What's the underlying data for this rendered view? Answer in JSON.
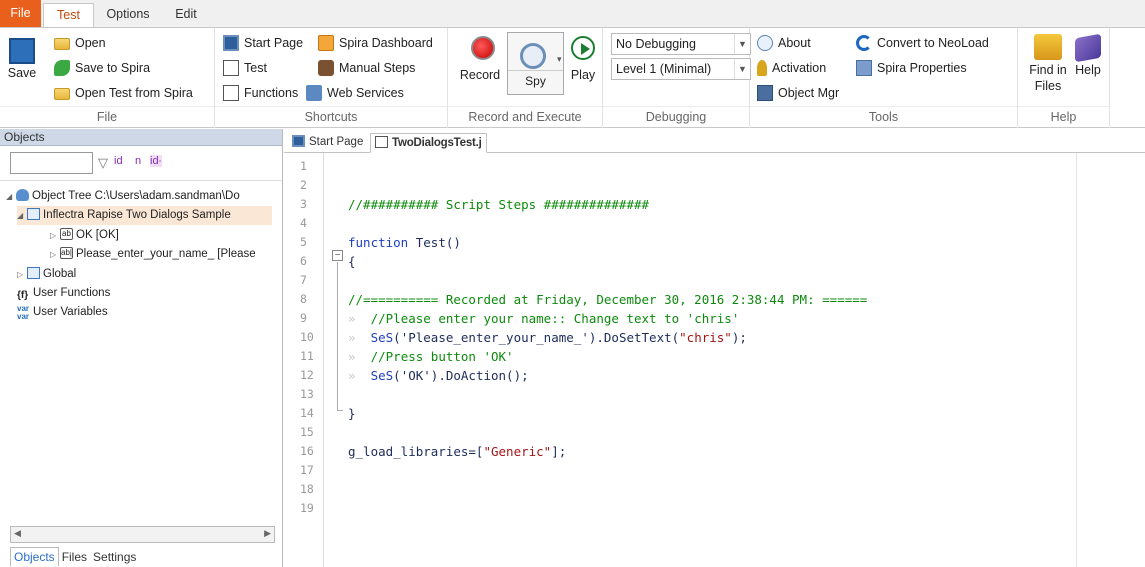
{
  "menu": {
    "tabs": [
      "File",
      "Test",
      "Options",
      "Edit"
    ]
  },
  "ribbon": {
    "file_group": {
      "save": "Save",
      "open": "Open",
      "save_spira": "Save to Spira",
      "open_spira": "Open Test from Spira",
      "caption": "File"
    },
    "shortcuts_group": {
      "start_page": "Start Page",
      "spira_dashboard": "Spira Dashboard",
      "test": "Test",
      "manual_steps": "Manual Steps",
      "functions": "Functions",
      "web_services": "Web Services",
      "caption": "Shortcuts"
    },
    "record_group": {
      "record": "Record",
      "spy": "Spy",
      "play": "Play",
      "caption": "Record and Execute"
    },
    "debug_group": {
      "debug_mode": "No Debugging",
      "debug_level": "Level 1 (Minimal)",
      "caption": "Debugging"
    },
    "tools_group": {
      "about": "About",
      "activation": "Activation",
      "object_mgr": "Object Mgr",
      "convert": "Convert to NeoLoad",
      "spira_props": "Spira Properties",
      "caption": "Tools"
    },
    "help_group": {
      "find_line1": "Find in",
      "find_line2": "Files",
      "help": "Help",
      "caption": "Help"
    }
  },
  "left_panel": {
    "header": "Objects",
    "filter_tags": [
      "id",
      "n",
      "id∙"
    ],
    "tree": [
      {
        "label": "Object Tree C:\\Users\\adam.sandman\\Do"
      },
      {
        "label": "Inflectra Rapise Two Dialogs Sample"
      },
      {
        "label": "OK [OK]"
      },
      {
        "label": "Please_enter_your_name_ [Please"
      },
      {
        "label": "Global"
      },
      {
        "label": "User Functions"
      },
      {
        "label": "User Variables"
      }
    ],
    "bottom_tabs": [
      "Objects",
      "Files",
      "Settings"
    ]
  },
  "editor": {
    "tabs": [
      "Start Page",
      "TwoDialogsTest.j"
    ],
    "line_numbers": [
      "1",
      "2",
      "3",
      "4",
      "5",
      "6",
      "7",
      "8",
      "9",
      "10",
      "11",
      "12",
      "13",
      "14",
      "15",
      "16",
      "17",
      "18",
      "19"
    ],
    "lines": {
      "l3": "//########## Script Steps ##############",
      "l5_kw": "function",
      "l5_rest": " Test()",
      "l6": "{",
      "l8": "//========== Recorded at Friday, December 30, 2016 2:38:44 PM: ======",
      "l9": "//Please enter your name:: Change text to 'chris'",
      "l10_fn": "SeS",
      "l10_a": "('Please_enter_your_name_').DoSetText(",
      "l10_str": "\"chris\"",
      "l10_b": ");",
      "l11": "//Press button 'OK'",
      "l12_fn": "SeS",
      "l12_rest": "('OK').DoAction();",
      "l14": "}",
      "l16_a": "g_load_libraries=[",
      "l16_str": "\"Generic\"",
      "l16_b": "];"
    },
    "tab_glyph": "»",
    "fold_glyph": "−"
  }
}
